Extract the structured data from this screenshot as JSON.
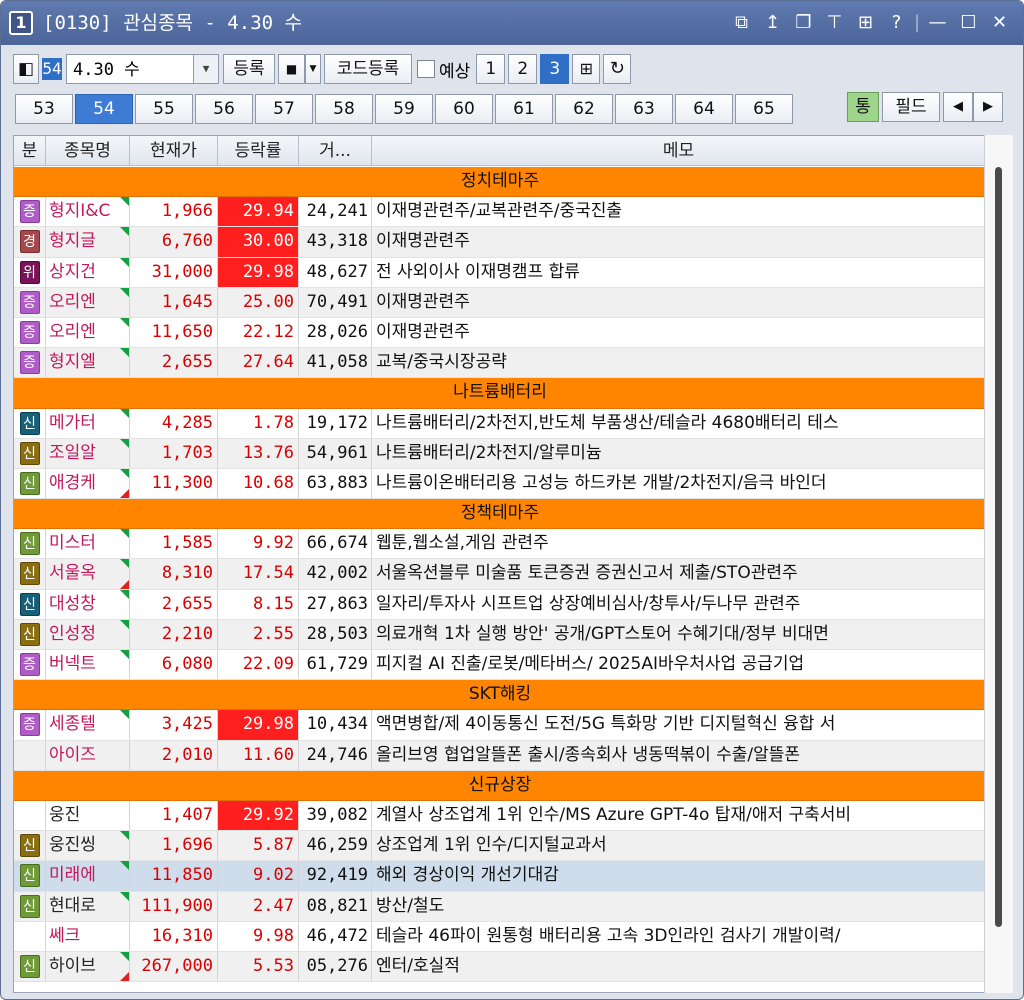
{
  "window": {
    "number": "1",
    "title": "[0130] 관심종목 - 4.30 수",
    "icons": [
      "window-icon",
      "pin-up-icon",
      "restore-icon",
      "pin-icon",
      "grid-icon",
      "help-icon",
      "minimize-icon",
      "maximize-icon",
      "close-icon"
    ],
    "glyphs": {
      "window": "⧉",
      "pinup": "↥",
      "restore": "❐",
      "pin": "⊤",
      "grid": "⊞",
      "help": "?",
      "minimize": "—",
      "maximize": "☐",
      "close": "✕"
    }
  },
  "toolbar": {
    "group_num": "54",
    "group_name": "4.30 수",
    "register": "등록",
    "code_register": "코드등록",
    "forecast": "예상",
    "pages": [
      "1",
      "2",
      "3"
    ],
    "active_page": "3"
  },
  "tabs": [
    "53",
    "54",
    "55",
    "56",
    "57",
    "58",
    "59",
    "60",
    "61",
    "62",
    "63",
    "64",
    "65"
  ],
  "active_tab": "54",
  "right_buttons": {
    "tong": "통",
    "field": "필드",
    "prev": "◀",
    "next": "▶"
  },
  "columns": {
    "cat": "분",
    "name": "종목명",
    "price": "현재가",
    "rate": "등락률",
    "volume": "거...",
    "memo": "메모"
  },
  "groups": [
    {
      "title": "정치테마주",
      "rows": [
        {
          "cat": "증",
          "badge": "jeung",
          "name": "형지I&C",
          "price": "1,966",
          "rate": "29.94",
          "limit": true,
          "volume": "24,241",
          "memo": "이재명관련주/교복관련주/중국진출",
          "tri": [
            "g"
          ]
        },
        {
          "cat": "경",
          "badge": "gyeong",
          "name": "형지글",
          "price": "6,760",
          "rate": "30.00",
          "limit": true,
          "volume": "43,318",
          "memo": "이재명관련주",
          "tri": [
            "g"
          ]
        },
        {
          "cat": "위",
          "badge": "wi",
          "name": "상지건",
          "price": "31,000",
          "rate": "29.98",
          "limit": true,
          "volume": "48,627",
          "memo": "전 사외이사 이재명캠프 합류",
          "tri": [
            "g"
          ]
        },
        {
          "cat": "증",
          "badge": "jeung",
          "name": "오리엔",
          "price": "1,645",
          "rate": "25.00",
          "limit": false,
          "volume": "70,491",
          "memo": "이재명관련주",
          "tri": [
            "g"
          ]
        },
        {
          "cat": "증",
          "badge": "jeung",
          "name": "오리엔",
          "price": "11,650",
          "rate": "22.12",
          "limit": false,
          "volume": "28,026",
          "memo": "이재명관련주",
          "tri": [
            "g"
          ]
        },
        {
          "cat": "증",
          "badge": "jeung",
          "name": "형지엘",
          "price": "2,655",
          "rate": "27.64",
          "limit": false,
          "volume": "41,058",
          "memo": "교복/중국시장공략",
          "tri": [
            "g"
          ]
        }
      ]
    },
    {
      "title": "나트륨배터리",
      "rows": [
        {
          "cat": "신",
          "badge": "sin-dark",
          "name": "메가터",
          "price": "4,285",
          "rate": "1.78",
          "limit": false,
          "volume": "19,172",
          "memo": "나트륨배터리/2차전지,반도체 부품생산/테슬라 4680배터리 테스",
          "tri": [
            "g"
          ]
        },
        {
          "cat": "신",
          "badge": "sin-olive",
          "name": "조일알",
          "price": "1,703",
          "rate": "13.76",
          "limit": false,
          "volume": "54,961",
          "memo": "나트륨배터리/2차전지/알루미늄",
          "tri": [
            "g"
          ]
        },
        {
          "cat": "신",
          "badge": "sin-green",
          "name": "애경케",
          "price": "11,300",
          "rate": "10.68",
          "limit": false,
          "volume": "63,883",
          "memo": "나트륨이온배터리용 고성능 하드카본 개발/2차전지/음극 바인더",
          "tri": [
            "g",
            "r"
          ]
        }
      ]
    },
    {
      "title": "정책테마주",
      "rows": [
        {
          "cat": "신",
          "badge": "sin-green",
          "name": "미스터",
          "price": "1,585",
          "rate": "9.92",
          "limit": false,
          "volume": "66,674",
          "memo": "웹툰,웹소설,게임 관련주",
          "tri": [
            "g"
          ]
        },
        {
          "cat": "신",
          "badge": "sin-olive",
          "name": "서울옥",
          "price": "8,310",
          "rate": "17.54",
          "limit": false,
          "volume": "42,002",
          "memo": "서울옥션블루 미술품 토큰증권 증권신고서 제출/STO관련주",
          "tri": [
            "g",
            "r"
          ]
        },
        {
          "cat": "신",
          "badge": "sin-dark",
          "name": "대성창",
          "price": "2,655",
          "rate": "8.15",
          "limit": false,
          "volume": "27,863",
          "memo": "일자리/투자사 시프트업 상장예비심사/창투사/두나무 관련주",
          "tri": [
            "g"
          ]
        },
        {
          "cat": "신",
          "badge": "sin-olive",
          "name": "인성정",
          "price": "2,210",
          "rate": "2.55",
          "limit": false,
          "volume": "28,503",
          "memo": "의료개혁 1차 실행 방안' 공개/GPT스토어 수혜기대/정부 비대면",
          "tri": [
            "g"
          ]
        },
        {
          "cat": "증",
          "badge": "jeung",
          "name": "버넥트",
          "price": "6,080",
          "rate": "22.09",
          "limit": false,
          "volume": "61,729",
          "memo": "피지컬 AI 진출/로봇/메타버스/ 2025AI바우처사업 공급기업",
          "tri": [
            "g"
          ]
        }
      ]
    },
    {
      "title": "SKT해킹",
      "rows": [
        {
          "cat": "증",
          "badge": "jeung",
          "name": "세종텔",
          "price": "3,425",
          "rate": "29.98",
          "limit": true,
          "volume": "10,434",
          "memo": "액면병합/제 4이동통신 도전/5G 특화망 기반 디지털혁신 융합 서",
          "tri": [
            "g"
          ]
        },
        {
          "cat": "",
          "badge": "",
          "name": "아이즈",
          "price": "2,010",
          "rate": "11.60",
          "limit": false,
          "volume": "24,746",
          "memo": "올리브영 협업알뜰폰 출시/종속회사 냉동떡볶이 수출/알뜰폰",
          "tri": []
        }
      ]
    },
    {
      "title": "신규상장",
      "rows": [
        {
          "cat": "",
          "badge": "",
          "name": "웅진",
          "price": "1,407",
          "rate": "29.92",
          "limit": true,
          "volume": "39,082",
          "memo": "계열사 상조업계 1위 인수/MS Azure GPT-4o 탑재/애저 구축서비",
          "tri": [],
          "dark_name": true
        },
        {
          "cat": "신",
          "badge": "sin-olive",
          "name": "웅진씽",
          "price": "1,696",
          "rate": "5.87",
          "limit": false,
          "volume": "46,259",
          "memo": "상조업계 1위 인수/디지털교과서",
          "tri": [
            "g"
          ],
          "dark_name": true
        },
        {
          "cat": "신",
          "badge": "sin-green",
          "name": "미래에",
          "price": "11,850",
          "rate": "9.02",
          "limit": false,
          "volume": "92,419",
          "memo": "해외 경상이익 개선기대감",
          "tri": [
            "g"
          ],
          "highlight": true
        },
        {
          "cat": "신",
          "badge": "sin-green",
          "name": "현대로",
          "price": "111,900",
          "rate": "2.47",
          "limit": false,
          "volume": "08,821",
          "memo": "방산/철도",
          "tri": [
            "g"
          ],
          "dark_name": true
        },
        {
          "cat": "",
          "badge": "",
          "name": "쎄크",
          "price": "16,310",
          "rate": "9.98",
          "limit": false,
          "volume": "46,472",
          "memo": "테슬라 46파이 원통형 배터리용 고속 3D인라인 검사기 개발이력/",
          "tri": []
        },
        {
          "cat": "신",
          "badge": "sin-green",
          "name": "하이브",
          "price": "267,000",
          "rate": "5.53",
          "limit": false,
          "volume": "05,276",
          "memo": "엔터/호실적",
          "tri": [
            "g",
            "r"
          ],
          "dark_name": true
        }
      ]
    }
  ]
}
